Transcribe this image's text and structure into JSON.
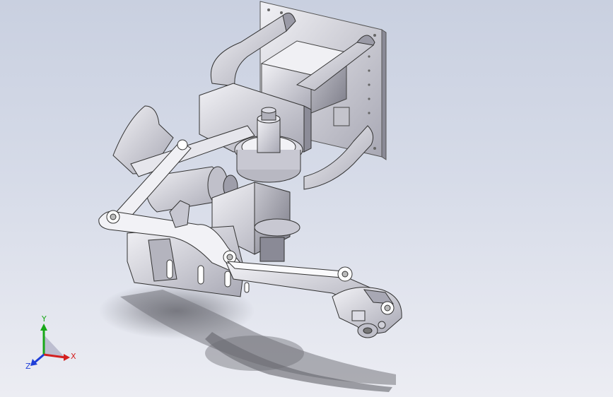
{
  "viewport": {
    "background_top": "#c9d0e0",
    "background_bottom": "#ecedf3"
  },
  "triad": {
    "x_label": "X",
    "y_label": "Y",
    "z_label": "Z",
    "x_color": "#d42020",
    "y_color": "#18a818",
    "z_color": "#1f3fd8"
  }
}
